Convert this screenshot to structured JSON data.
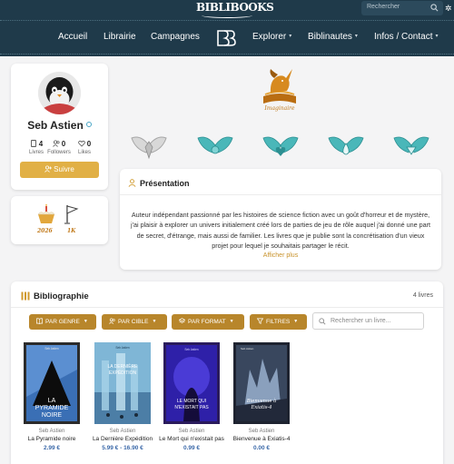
{
  "header": {
    "logo_text": "BIBLIBOOKS",
    "search_placeholder": "Rechercher"
  },
  "nav": {
    "items": [
      {
        "label": "Accueil",
        "has_caret": false
      },
      {
        "label": "Librairie",
        "has_caret": false
      },
      {
        "label": "Campagnes",
        "has_caret": false
      },
      {
        "label": "Explorer",
        "has_caret": true
      },
      {
        "label": "Biblinautes",
        "has_caret": true
      },
      {
        "label": "Infos / Contact",
        "has_caret": true
      }
    ]
  },
  "profile": {
    "name": "Seb Astien",
    "stats": [
      {
        "value": "4",
        "label": "Livres",
        "icon": "book-icon"
      },
      {
        "value": "0",
        "label": "Followers",
        "icon": "users-icon"
      },
      {
        "value": "0",
        "label": "Likes",
        "icon": "heart-icon"
      }
    ],
    "follow_label": "Suivre"
  },
  "badges": [
    {
      "label": "2026",
      "icon": "cake-icon"
    },
    {
      "label": "1K",
      "icon": "flag-icon"
    }
  ],
  "imaginaire_badge": {
    "label": "Imaginaire",
    "icon": "unicorn-book-icon"
  },
  "wing_badges": [
    "grey-wings-icon",
    "teal-wings-icon",
    "teal-heart-wings-icon",
    "teal-drop-wings-icon",
    "teal-diamond-wings-icon"
  ],
  "presentation": {
    "title": "Présentation",
    "text": "Auteur indépendant passionné par les histoires de science fiction avec un goût d'horreur et de mystère, j'ai plaisir à explorer un univers initialement créé lors de parties de jeu de rôle auquel j'ai donné une part de secret, d'étrange, mais aussi de familier. Les livres que je publie sont la concrétisation d'un vieux projet pour lequel je souhaitais partager le récit.",
    "more_label": "Afficher plus"
  },
  "bibliography": {
    "title": "Bibliographie",
    "count_label": "4 livres",
    "filters": [
      {
        "label": "PAR GENRE",
        "icon": "book-open-icon"
      },
      {
        "label": "PAR CIBLE",
        "icon": "users-icon"
      },
      {
        "label": "PAR FORMAT",
        "icon": "layers-icon"
      },
      {
        "label": "FILTRES",
        "icon": "funnel-icon"
      }
    ],
    "search_placeholder": "Rechercher un livre...",
    "books": [
      {
        "author": "Seb Astien",
        "title": "La Pyramide noire",
        "price": "2.99 €",
        "cover_title": "LA PYRAMIDE NOIRE",
        "cover_author": "Seb Astien"
      },
      {
        "author": "Seb Astien",
        "title": "La Dernière Expédition",
        "price": "5.99 € - 16.90 €",
        "cover_title": "LA DERNIÈRE EXPÉDITION",
        "cover_author": "Seb Astien"
      },
      {
        "author": "Seb Astien",
        "title": "Le Mort qui n'existait pas",
        "price": "0.99 €",
        "cover_title": "LE MORT QUI N'EXISTAIT PAS",
        "cover_author": "Seb Astien"
      },
      {
        "author": "Seb Astien",
        "title": "Bienvenue à Exiatis-4",
        "price": "0.00 €",
        "cover_title": "Bienvenue à Exiatis-4",
        "cover_author": "Seb Astien"
      }
    ]
  },
  "colors": {
    "header_bg": "#1f3a4a",
    "accent_gold": "#e1b046",
    "filter_gold": "#b8862b",
    "teal": "#4ab7b9",
    "price_blue": "#3a68a8"
  }
}
